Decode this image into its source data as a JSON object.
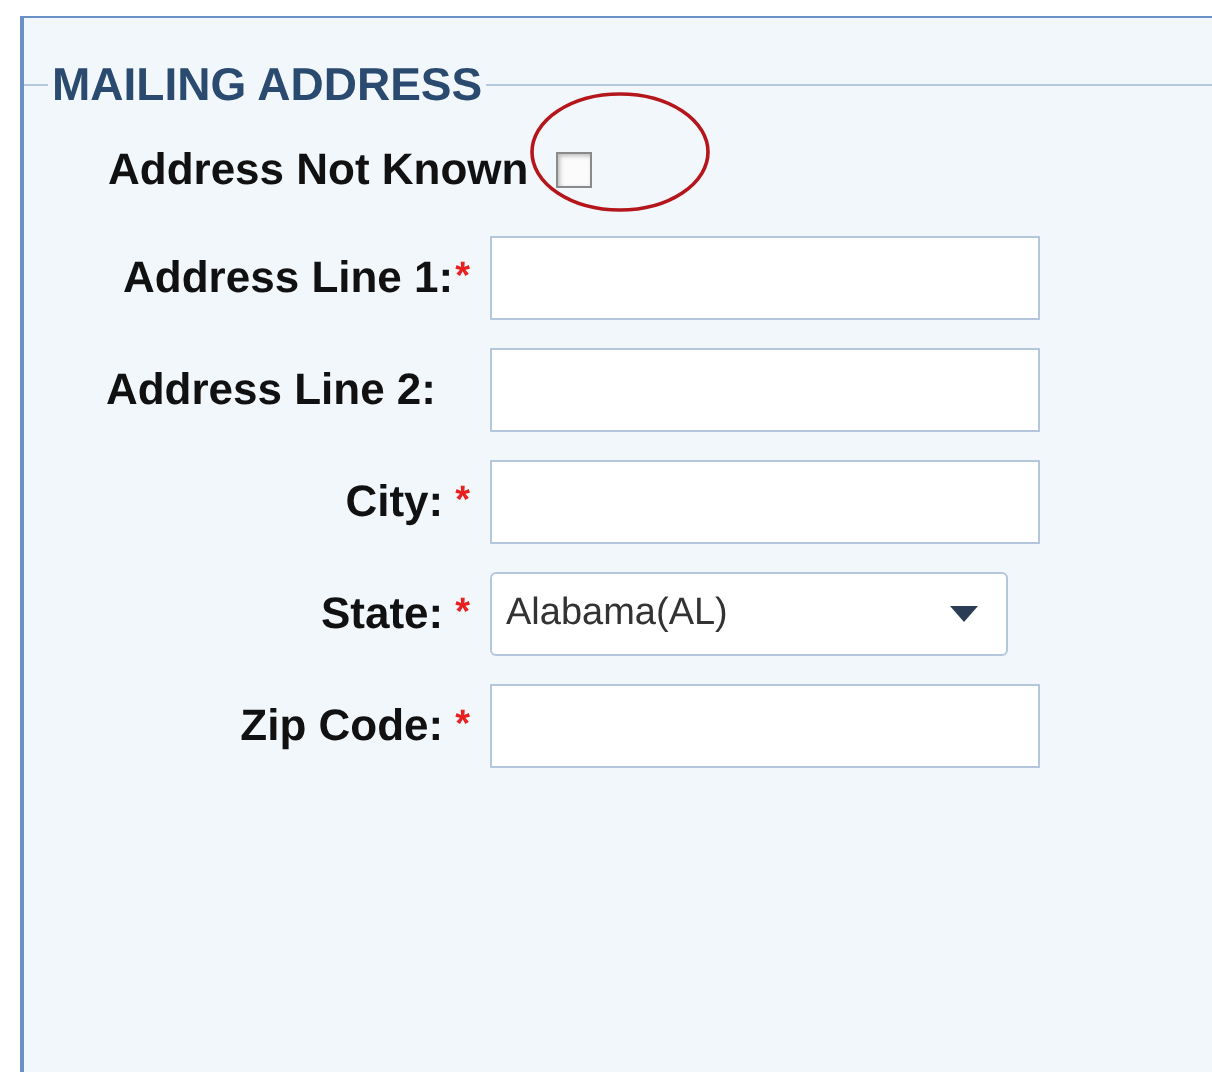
{
  "section": {
    "title": "MAILING ADDRESS"
  },
  "address_not_known": {
    "label": "Address Not Known",
    "checked": false,
    "highlighted": true
  },
  "fields": [
    {
      "kind": "text",
      "label": "Address Line 1:",
      "required_mark": "*"
    },
    {
      "kind": "text",
      "label": "Address Line 2:"
    },
    {
      "kind": "text",
      "label": "City:",
      "required_mark": "*"
    },
    {
      "kind": "select",
      "label": "State:",
      "required_mark": "*",
      "value": "Alabama(AL)"
    },
    {
      "kind": "text",
      "label": "Zip Code:",
      "required_mark": "*"
    }
  ]
}
